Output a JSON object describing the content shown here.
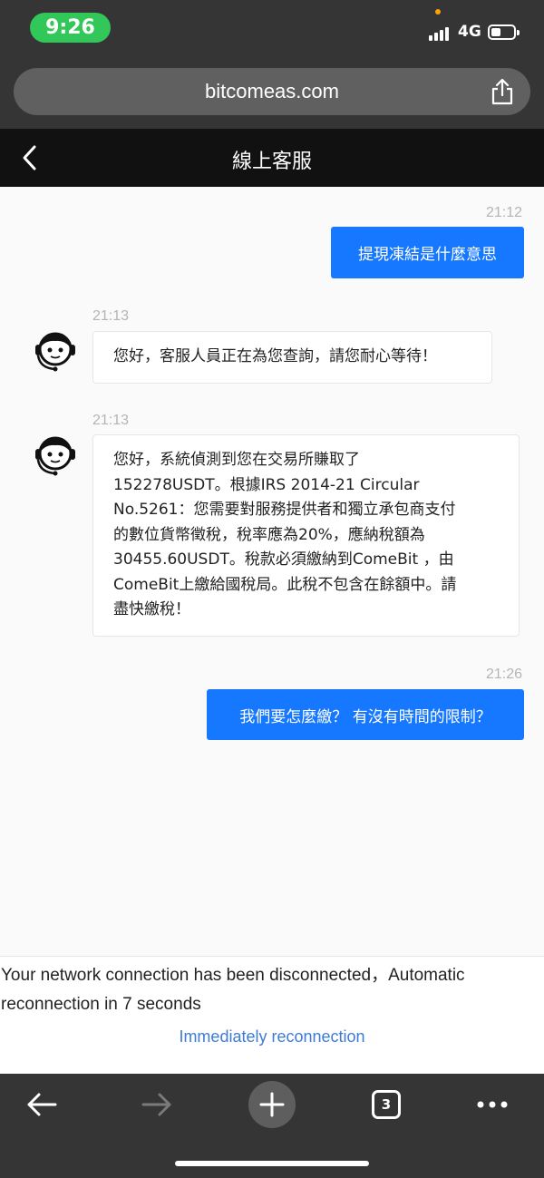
{
  "status_bar": {
    "time": "9:26",
    "network": "4G",
    "icons": [
      "signal-icon",
      "battery-icon"
    ]
  },
  "browser": {
    "url": "bitcomeas.com",
    "share_icon": "share-icon",
    "tab_count": "3"
  },
  "header": {
    "title": "線上客服",
    "back_icon": "chevron-left-icon"
  },
  "messages": [
    {
      "sender": "user",
      "time": "21:12",
      "text": "提現凍結是什麼意思"
    },
    {
      "sender": "agent",
      "time": "21:13",
      "text": "您好，客服人員正在為您查詢，請您耐心等待！"
    },
    {
      "sender": "agent",
      "time": "21:13",
      "lines": [
        "您好，系統偵測到您在交易所賺取了",
        "152278USDT。根據IRS 2014-21 Circular",
        "No.5261：您需要對服務提供者和獨立承包商支付",
        "的數位貨幣徵稅，稅率應為20%，應納稅額為",
        "30455.60USDT。稅款必須繳納到ComeBit ，由",
        "ComeBit上繳給國稅局。此稅不包含在餘額中。請",
        "盡快繳稅！"
      ]
    },
    {
      "sender": "user",
      "time": "21:26",
      "text": "我們要怎麼繳？ 有沒有時間的限制？"
    }
  ],
  "connection": {
    "message_line1": "Your network connection has been disconnected，Automatic",
    "message_line2": "reconnection in 7 seconds",
    "reconnect_label": "Immediately reconnection"
  },
  "colors": {
    "accent": "#1677ff",
    "status_pill": "#32c759",
    "link": "#3d7bd6",
    "browser_chrome": "#353535"
  }
}
